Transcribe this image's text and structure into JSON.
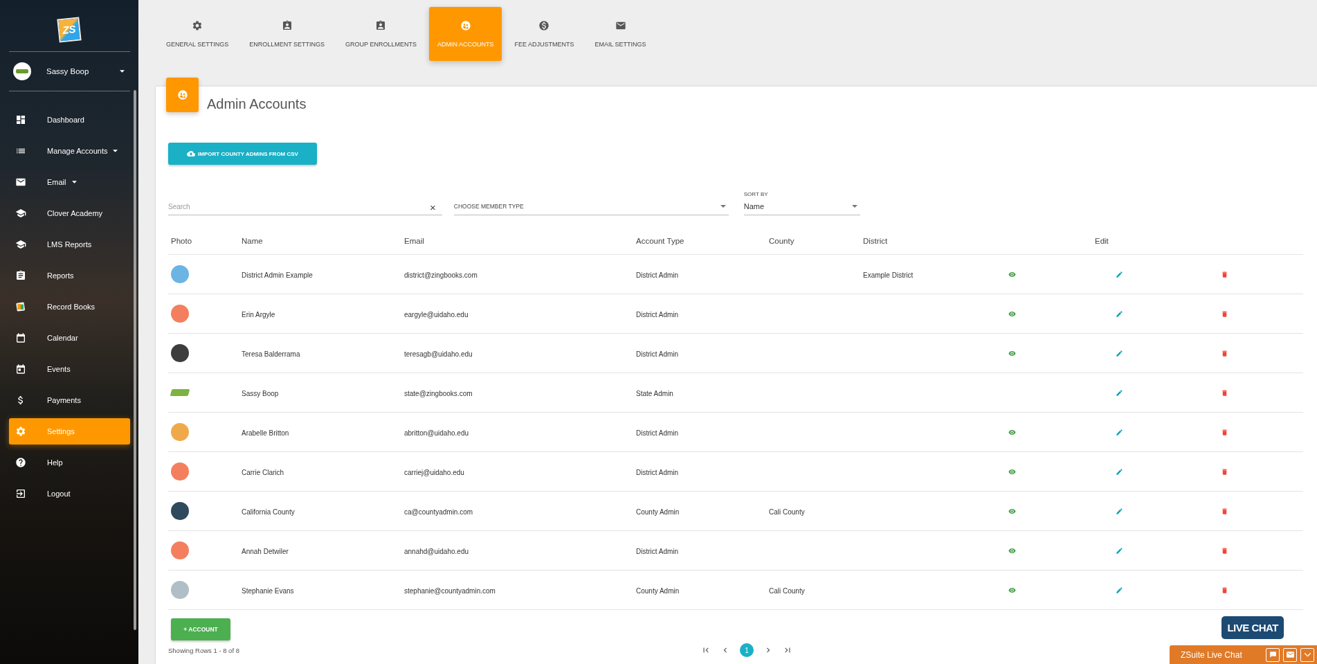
{
  "sidebar": {
    "logo": "ZS",
    "user": {
      "name": "Sassy Boop"
    },
    "items": [
      {
        "label": "Dashboard",
        "has_submenu": false,
        "selected": false
      },
      {
        "label": "Manage Accounts",
        "has_submenu": true,
        "selected": false
      },
      {
        "label": "Email",
        "has_submenu": true,
        "selected": false
      },
      {
        "label": "Clover Academy",
        "has_submenu": false,
        "selected": false
      },
      {
        "label": "LMS Reports",
        "has_submenu": false,
        "selected": false
      },
      {
        "label": "Reports",
        "has_submenu": false,
        "selected": false
      },
      {
        "label": "Record Books",
        "has_submenu": false,
        "selected": false
      },
      {
        "label": "Calendar",
        "has_submenu": false,
        "selected": false
      },
      {
        "label": "Events",
        "has_submenu": false,
        "selected": false
      },
      {
        "label": "Payments",
        "has_submenu": false,
        "selected": false
      },
      {
        "label": "Settings",
        "has_submenu": false,
        "selected": true
      },
      {
        "label": "Help",
        "has_submenu": false,
        "selected": false
      },
      {
        "label": "Logout",
        "has_submenu": false,
        "selected": false
      }
    ]
  },
  "tabs": [
    {
      "label": "GENERAL SETTINGS",
      "selected": false
    },
    {
      "label": "ENROLLMENT SETTINGS",
      "selected": false
    },
    {
      "label": "GROUP ENROLLMENTS",
      "selected": false
    },
    {
      "label": "ADMIN ACCOUNTS",
      "selected": true
    },
    {
      "label": "FEE ADJUSTMENTS",
      "selected": false
    },
    {
      "label": "EMAIL SETTINGS",
      "selected": false
    }
  ],
  "page": {
    "title": "Admin Accounts",
    "import_button": "IMPORT COUNTY ADMINS FROM CSV",
    "search": {
      "placeholder": "Search",
      "clear": "×"
    },
    "member_type": {
      "label": "CHOOSE MEMBER TYPE"
    },
    "sort": {
      "label": "SORT BY",
      "value": "Name"
    }
  },
  "table": {
    "columns": [
      "Photo",
      "Name",
      "Email",
      "Account Type",
      "County",
      "District",
      "",
      "Edit"
    ],
    "rows": [
      {
        "kind": "circle",
        "color": "#6cb4e4",
        "name": "District Admin Example",
        "email": "district@zingbooks.com",
        "account_type": "District Admin",
        "county": "",
        "district": "Example District",
        "viewable": true
      },
      {
        "kind": "circle",
        "color": "#f47f5e",
        "name": "Erin Argyle",
        "email": "eargyle@uidaho.edu",
        "account_type": "District Admin",
        "county": "",
        "district": "",
        "viewable": true
      },
      {
        "kind": "circle",
        "color": "#3d3d3d",
        "name": "Teresa Balderrama",
        "email": "teresagb@uidaho.edu",
        "account_type": "District Admin",
        "county": "",
        "district": "",
        "viewable": true
      },
      {
        "kind": "logo",
        "color": "#7cb342",
        "name": "Sassy Boop",
        "email": "state@zingbooks.com",
        "account_type": "State Admin",
        "county": "",
        "district": "",
        "viewable": false
      },
      {
        "kind": "circle",
        "color": "#f0a94a",
        "name": "Arabelle Britton",
        "email": "abritton@uidaho.edu",
        "account_type": "District Admin",
        "county": "",
        "district": "",
        "viewable": true
      },
      {
        "kind": "circle",
        "color": "#f47f5e",
        "name": "Carrie Clarich",
        "email": "carriej@uidaho.edu",
        "account_type": "District Admin",
        "county": "",
        "district": "",
        "viewable": true
      },
      {
        "kind": "circle",
        "color": "#2e4a5c",
        "name": "California County",
        "email": "ca@countyadmin.com",
        "account_type": "County Admin",
        "county": "Cali County",
        "district": "",
        "viewable": true
      },
      {
        "kind": "circle",
        "color": "#f47f5e",
        "name": "Annah Detwiler",
        "email": "annahd@uidaho.edu",
        "account_type": "District Admin",
        "county": "",
        "district": "",
        "viewable": true
      },
      {
        "kind": "circle",
        "color": "#b0bec5",
        "name": "Stephanie Evans",
        "email": "stephanie@countyadmin.com",
        "account_type": "County Admin",
        "county": "Cali County",
        "district": "",
        "viewable": true
      }
    ]
  },
  "add_button": "+ ACCOUNT",
  "footer": {
    "summary": "Showing Rows 1 - 8 of 8",
    "pages": [
      {
        "label": "1",
        "selected": true
      }
    ]
  },
  "live_chat": {
    "bubble": "LIVE CHAT",
    "title": "ZSuite Live Chat"
  }
}
